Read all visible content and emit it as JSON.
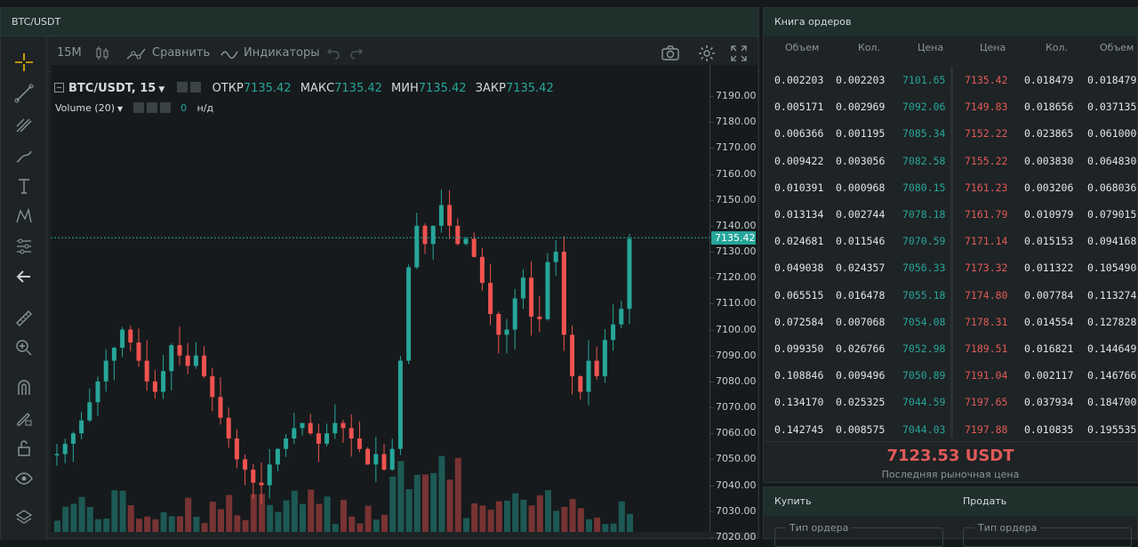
{
  "chart": {
    "title": "BTC/USDT",
    "timeframe": "15M",
    "compare_label": "Сравнить",
    "indicators_label": "Индикаторы",
    "symbol_label": "BTC/USDT, 15",
    "open_label": "ОТКР",
    "open_value": "7135.42",
    "high_label": "МАКС",
    "high_value": "7135.42",
    "low_label": "МИН",
    "low_value": "7135.42",
    "close_label": "ЗАКР",
    "close_value": "7135.42",
    "volume_label": "Volume (20)",
    "volume_value": "0",
    "volume_na": "н/д",
    "current_price_tag": "7135.42",
    "price_ticks": [
      "7190.00",
      "7180.00",
      "7170.00",
      "7160.00",
      "7150.00",
      "7140.00",
      "7130.00",
      "7120.00",
      "7110.00",
      "7100.00",
      "7090.00",
      "7080.00",
      "7070.00",
      "7060.00",
      "7050.00",
      "7040.00",
      "7030.00",
      "7020.00"
    ],
    "colors": {
      "up": "#26a69a",
      "down": "#ef5350"
    }
  },
  "orderbook": {
    "title": "Книга ордеров",
    "columns": [
      "Объем",
      "Кол.",
      "Цена",
      "Цена",
      "Кол.",
      "Объем"
    ],
    "bids": [
      [
        "0.002203",
        "0.002203",
        "7101.65"
      ],
      [
        "0.005171",
        "0.002969",
        "7092.06"
      ],
      [
        "0.006366",
        "0.001195",
        "7085.34"
      ],
      [
        "0.009422",
        "0.003056",
        "7082.58"
      ],
      [
        "0.010391",
        "0.000968",
        "7080.15"
      ],
      [
        "0.013134",
        "0.002744",
        "7078.18"
      ],
      [
        "0.024681",
        "0.011546",
        "7070.59"
      ],
      [
        "0.049038",
        "0.024357",
        "7056.33"
      ],
      [
        "0.065515",
        "0.016478",
        "7055.18"
      ],
      [
        "0.072584",
        "0.007068",
        "7054.08"
      ],
      [
        "0.099350",
        "0.026766",
        "7052.98"
      ],
      [
        "0.108846",
        "0.009496",
        "7050.89"
      ],
      [
        "0.134170",
        "0.025325",
        "7044.59"
      ],
      [
        "0.142745",
        "0.008575",
        "7044.03"
      ]
    ],
    "asks": [
      [
        "7135.42",
        "0.018479",
        "0.018479"
      ],
      [
        "7149.83",
        "0.018656",
        "0.037135"
      ],
      [
        "7152.22",
        "0.023865",
        "0.061000"
      ],
      [
        "7155.22",
        "0.003830",
        "0.064830"
      ],
      [
        "7161.23",
        "0.003206",
        "0.068036"
      ],
      [
        "7161.79",
        "0.010979",
        "0.079015"
      ],
      [
        "7171.14",
        "0.015153",
        "0.094168"
      ],
      [
        "7173.32",
        "0.011322",
        "0.105490"
      ],
      [
        "7174.80",
        "0.007784",
        "0.113274"
      ],
      [
        "7178.31",
        "0.014554",
        "0.127828"
      ],
      [
        "7189.51",
        "0.016821",
        "0.144649"
      ],
      [
        "7191.04",
        "0.002117",
        "0.146766"
      ],
      [
        "7197.65",
        "0.037934",
        "0.184700"
      ],
      [
        "7197.88",
        "0.010835",
        "0.195535"
      ]
    ],
    "last_price": "7123.53 USDT",
    "last_price_label": "Последняя рыночная цена"
  },
  "trade": {
    "buy_label": "Купить",
    "sell_label": "Продать",
    "order_type_label": "Тип ордера"
  }
}
